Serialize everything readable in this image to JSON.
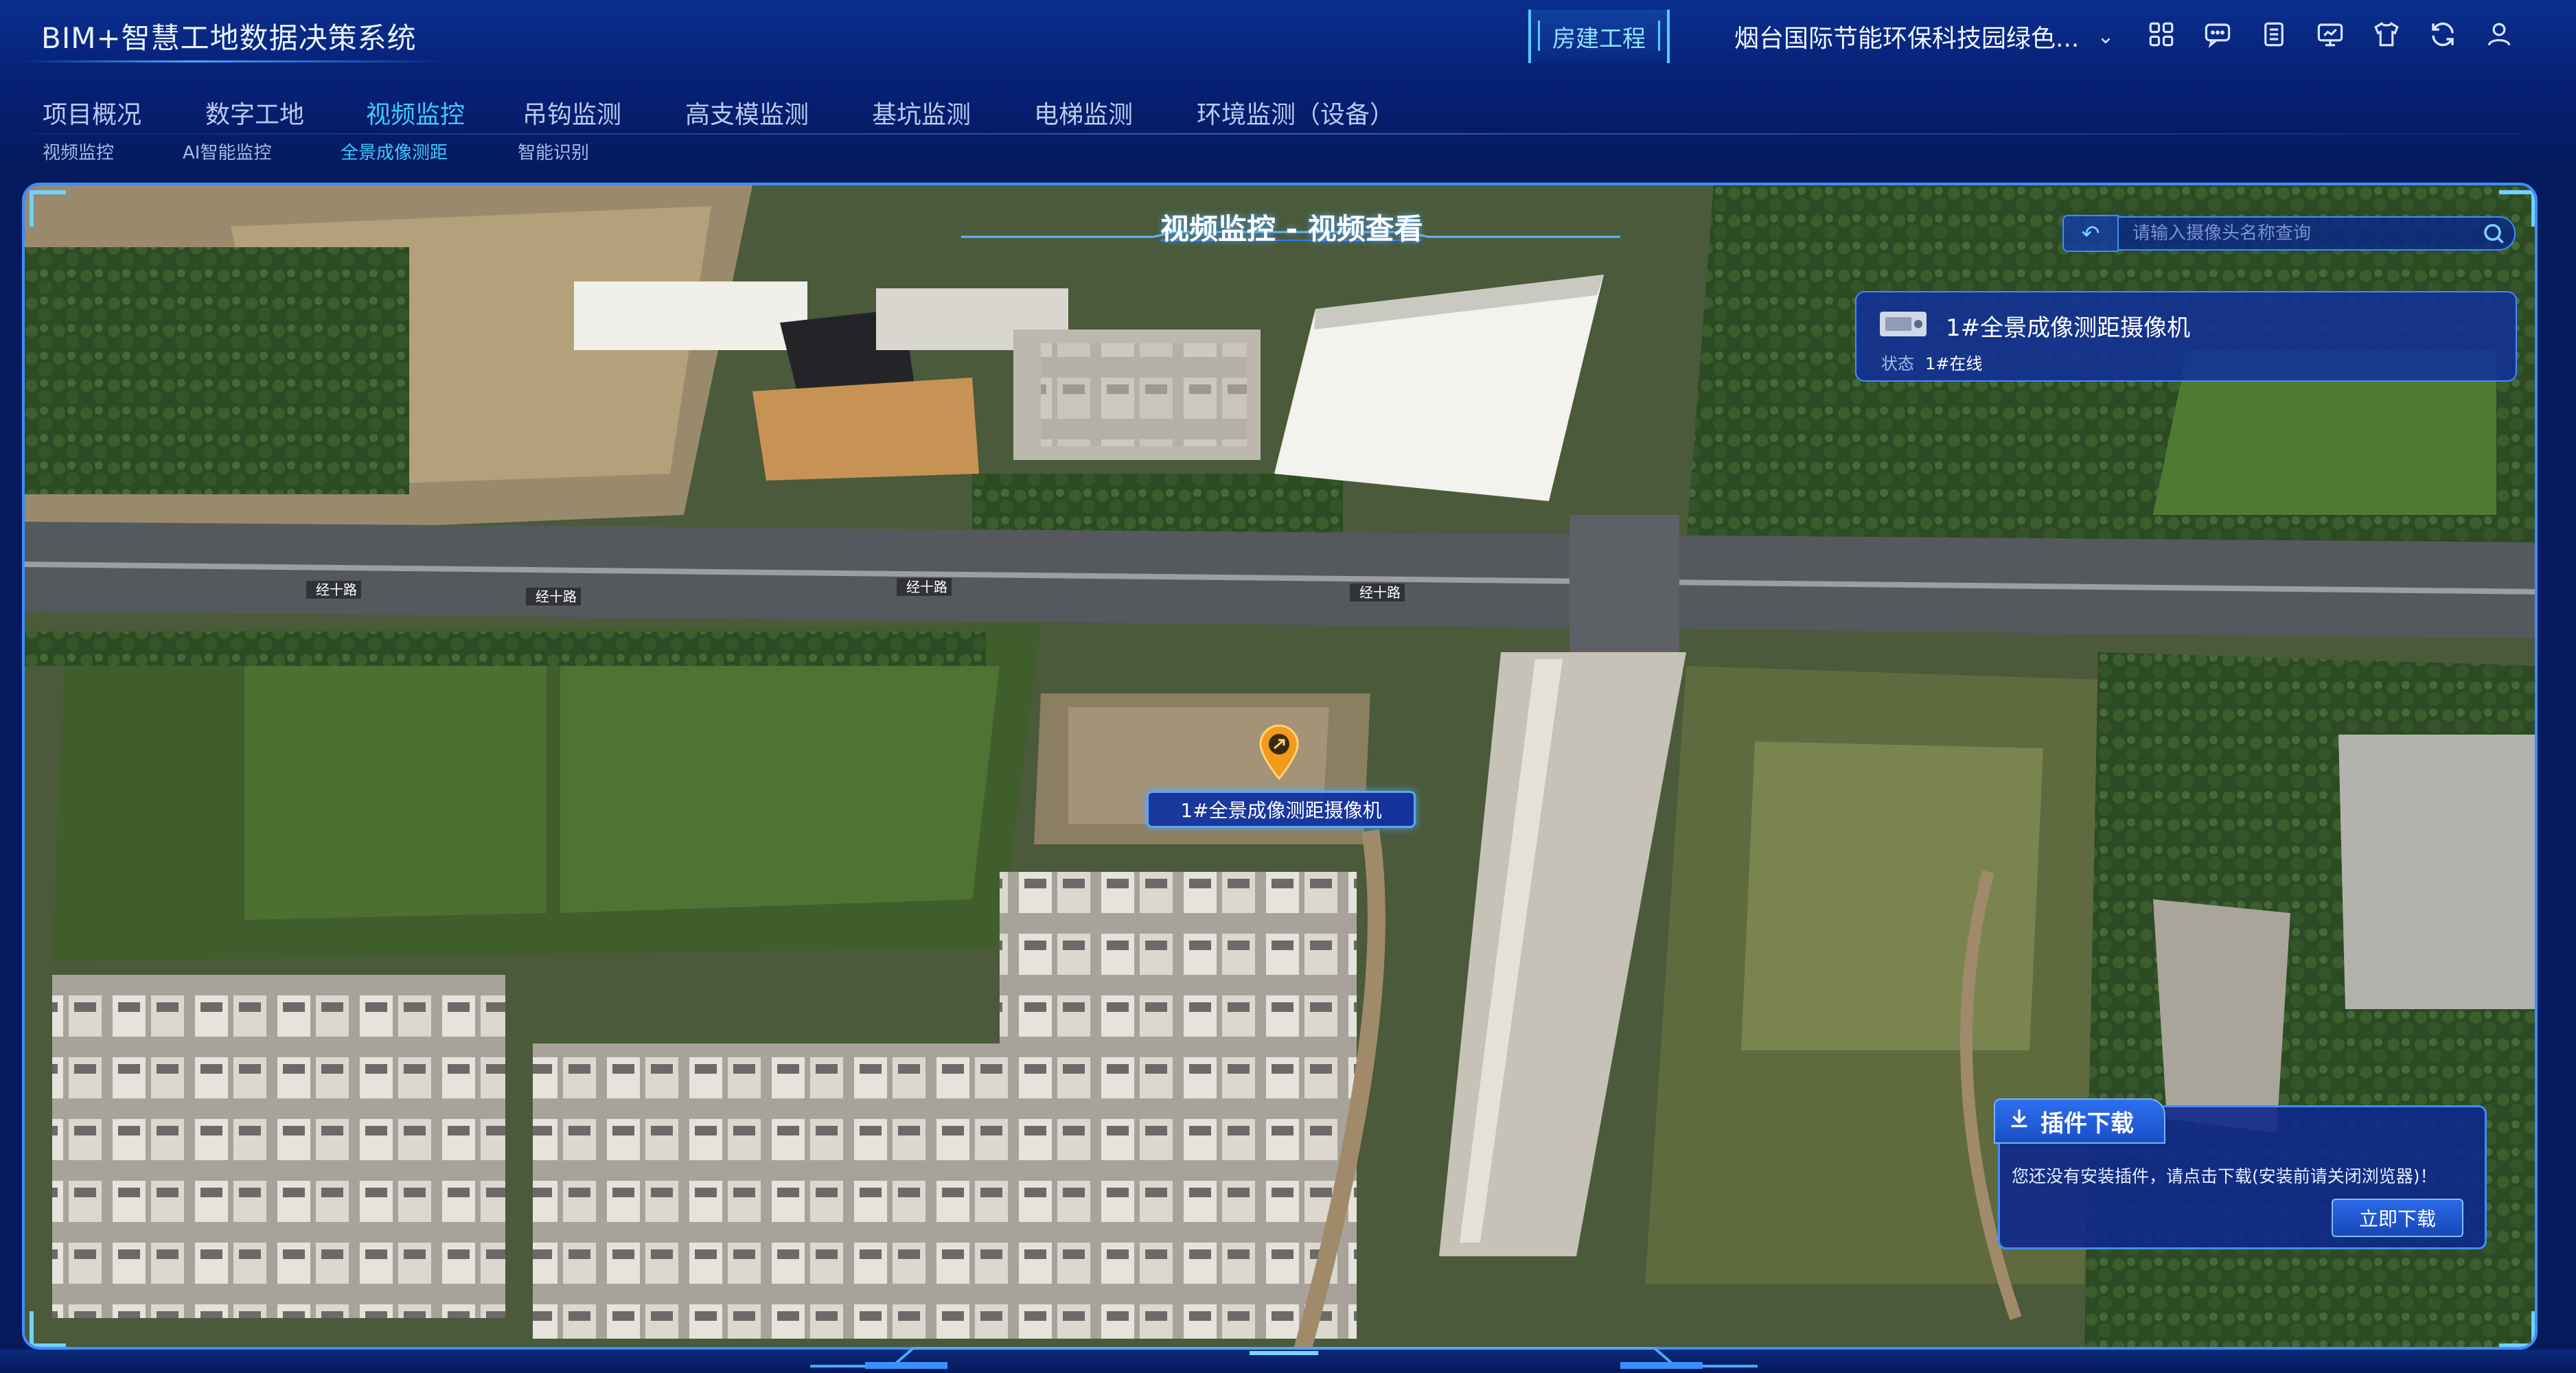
{
  "header": {
    "app_title": "BIM+智慧工地数据决策系统",
    "mode_label": "房建工程",
    "project_name": "烟台国际节能环保科技园绿色...",
    "toolbar_icons": [
      "grid-icon",
      "message-icon",
      "document-icon",
      "monitor-icon",
      "shirt-icon",
      "refresh-icon",
      "user-icon"
    ]
  },
  "main_nav": {
    "tabs": [
      {
        "label": "项目概况",
        "active": false
      },
      {
        "label": "数字工地",
        "active": false
      },
      {
        "label": "视频监控",
        "active": true
      },
      {
        "label": "吊钩监测",
        "active": false
      },
      {
        "label": "高支模监测",
        "active": false
      },
      {
        "label": "基坑监测",
        "active": false
      },
      {
        "label": "电梯监测",
        "active": false
      },
      {
        "label": "环境监测（设备）",
        "active": false
      }
    ]
  },
  "sub_nav": {
    "items": [
      {
        "label": "视频监控",
        "active": false
      },
      {
        "label": "AI智能监控",
        "active": false
      },
      {
        "label": "全景成像测距",
        "active": true
      },
      {
        "label": "智能识别",
        "active": false
      }
    ]
  },
  "map": {
    "view_title": "视频监控 - 视频查看",
    "search_placeholder": "请输入摄像头名称查询",
    "road_labels": [
      "经十路",
      "经十路",
      "经十路",
      "经十路"
    ],
    "colors": {
      "accent": "#3ec8ff",
      "frame": "#3f8dff",
      "marker": "#f39a1a"
    }
  },
  "camera_card": {
    "name": "1#全景成像测距摄像机",
    "status_label": "状态",
    "status": "1#在线"
  },
  "marker": {
    "label": "1#全景成像测距摄像机"
  },
  "plugin": {
    "title": "插件下载",
    "message": "您还没有安装插件，请点击下载(安装前请关闭浏览器)！",
    "button_label": "立即下载"
  }
}
